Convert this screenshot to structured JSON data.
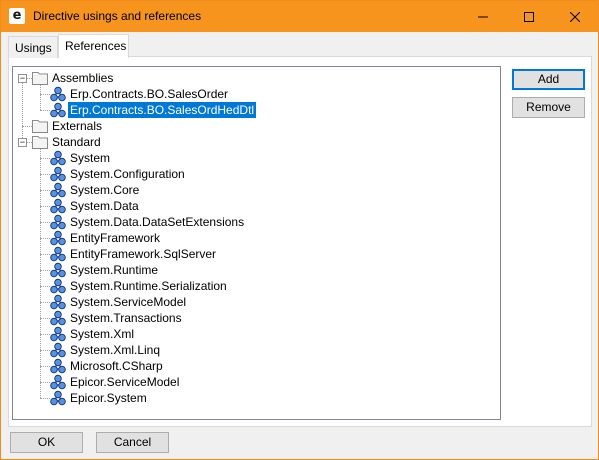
{
  "window": {
    "title": "Directive usings and references",
    "app_icon_letter": "e",
    "accent_color": "#f7941d"
  },
  "tabs": [
    {
      "label": "Usings",
      "active": false
    },
    {
      "label": "References",
      "active": true
    }
  ],
  "tree": {
    "nodes": [
      {
        "label": "Assemblies",
        "type": "folder",
        "level": 0,
        "expanded": true
      },
      {
        "label": "Erp.Contracts.BO.SalesOrder",
        "type": "assembly",
        "level": 1
      },
      {
        "label": "Erp.Contracts.BO.SalesOrdHedDtl",
        "type": "assembly",
        "level": 1,
        "selected": true
      },
      {
        "label": "Externals",
        "type": "folder",
        "level": 0
      },
      {
        "label": "Standard",
        "type": "folder",
        "level": 0,
        "expanded": true
      },
      {
        "label": "System",
        "type": "assembly",
        "level": 1
      },
      {
        "label": "System.Configuration",
        "type": "assembly",
        "level": 1
      },
      {
        "label": "System.Core",
        "type": "assembly",
        "level": 1
      },
      {
        "label": "System.Data",
        "type": "assembly",
        "level": 1
      },
      {
        "label": "System.Data.DataSetExtensions",
        "type": "assembly",
        "level": 1
      },
      {
        "label": "EntityFramework",
        "type": "assembly",
        "level": 1
      },
      {
        "label": "EntityFramework.SqlServer",
        "type": "assembly",
        "level": 1
      },
      {
        "label": "System.Runtime",
        "type": "assembly",
        "level": 1
      },
      {
        "label": "System.Runtime.Serialization",
        "type": "assembly",
        "level": 1
      },
      {
        "label": "System.ServiceModel",
        "type": "assembly",
        "level": 1
      },
      {
        "label": "System.Transactions",
        "type": "assembly",
        "level": 1
      },
      {
        "label": "System.Xml",
        "type": "assembly",
        "level": 1
      },
      {
        "label": "System.Xml.Linq",
        "type": "assembly",
        "level": 1
      },
      {
        "label": "Microsoft.CSharp",
        "type": "assembly",
        "level": 1
      },
      {
        "label": "Epicor.ServiceModel",
        "type": "assembly",
        "level": 1
      },
      {
        "label": "Epicor.System",
        "type": "assembly",
        "level": 1
      }
    ]
  },
  "buttons": {
    "add": "Add",
    "remove": "Remove",
    "ok": "OK",
    "cancel": "Cancel"
  }
}
